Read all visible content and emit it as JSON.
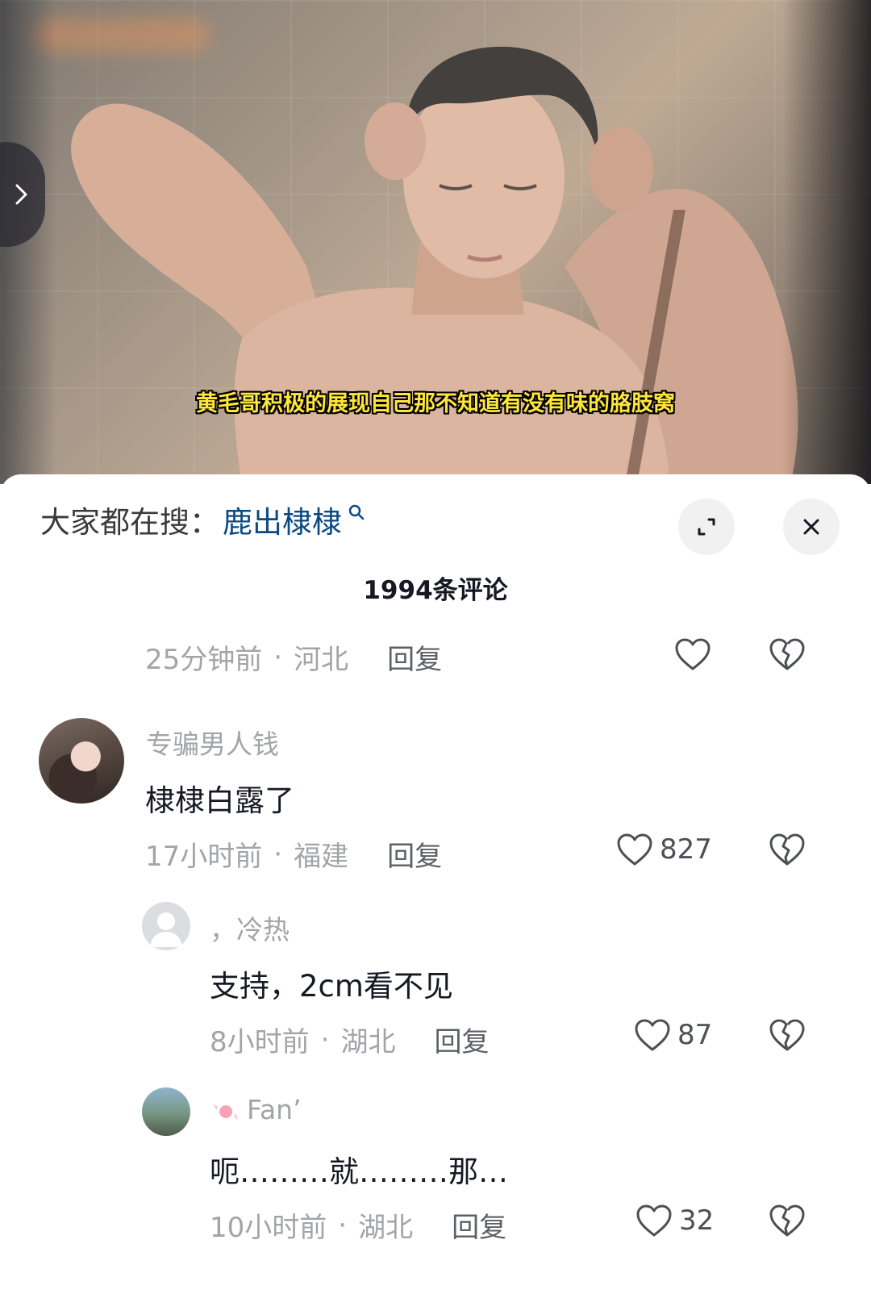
{
  "video": {
    "subtitle": "黄毛哥积极的展现自己那不知道有没有味的胳肢窝"
  },
  "sheet": {
    "search_prefix": "大家都在搜：",
    "search_term": "鹿出棣棣",
    "comment_count": "1994条评论"
  },
  "comments": [
    {
      "time": "25分钟前",
      "location": "河北",
      "reply_label": "回复",
      "likes": ""
    },
    {
      "username": "专骗男人钱",
      "text": "棣棣白露了",
      "time": "17小时前",
      "location": "福建",
      "reply_label": "回复",
      "likes": "827"
    },
    {
      "username": "，冷热",
      "text": "支持，2cm看不见",
      "time": "8小时前",
      "location": "湖北",
      "reply_label": "回复",
      "likes": "87"
    },
    {
      "username": "Fan’",
      "text": "呃………就………那…",
      "time": "10小时前",
      "location": "湖北",
      "reply_label": "回复",
      "likes": "32"
    }
  ],
  "separator": "·"
}
